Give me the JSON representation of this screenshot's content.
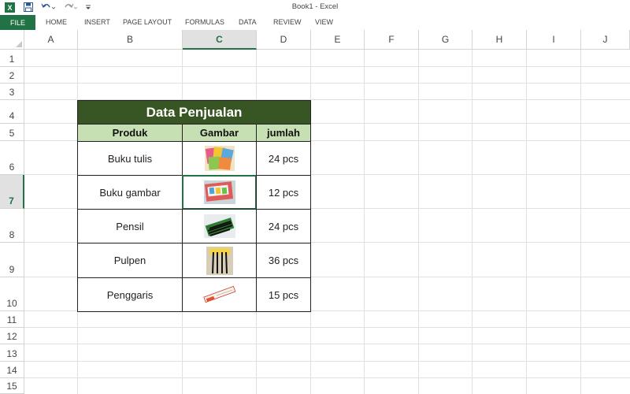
{
  "window": {
    "title": "Book1 - Excel"
  },
  "ribbon": {
    "file_label": "FILE",
    "tabs": [
      "HOME",
      "INSERT",
      "PAGE LAYOUT",
      "FORMULAS",
      "DATA",
      "REVIEW",
      "VIEW"
    ]
  },
  "columns": [
    "A",
    "B",
    "C",
    "D",
    "E",
    "F",
    "G",
    "H",
    "I",
    "J"
  ],
  "rows": [
    "1",
    "2",
    "3",
    "4",
    "5",
    "6",
    "7",
    "8",
    "9",
    "10",
    "11",
    "12",
    "13",
    "14",
    "15"
  ],
  "selected_cell": {
    "column": "C",
    "row": "7"
  },
  "table": {
    "title": "Data Penjualan",
    "headers": [
      "Produk",
      "Gambar",
      "jumlah"
    ],
    "rows": [
      {
        "produk": "Buku tulis",
        "gambar": "notebooks-image",
        "jumlah": "24 pcs"
      },
      {
        "produk": "Buku gambar",
        "gambar": "drawing-book-image",
        "jumlah": "12 pcs"
      },
      {
        "produk": "Pensil",
        "gambar": "pencils-image",
        "jumlah": "24 pcs"
      },
      {
        "produk": "Pulpen",
        "gambar": "pens-image",
        "jumlah": "36 pcs"
      },
      {
        "produk": "Penggaris",
        "gambar": "ruler-image",
        "jumlah": "15 pcs"
      }
    ]
  },
  "colors": {
    "excel_green": "#217346",
    "title_fill": "#375623",
    "header_fill": "#c6e0b4"
  }
}
